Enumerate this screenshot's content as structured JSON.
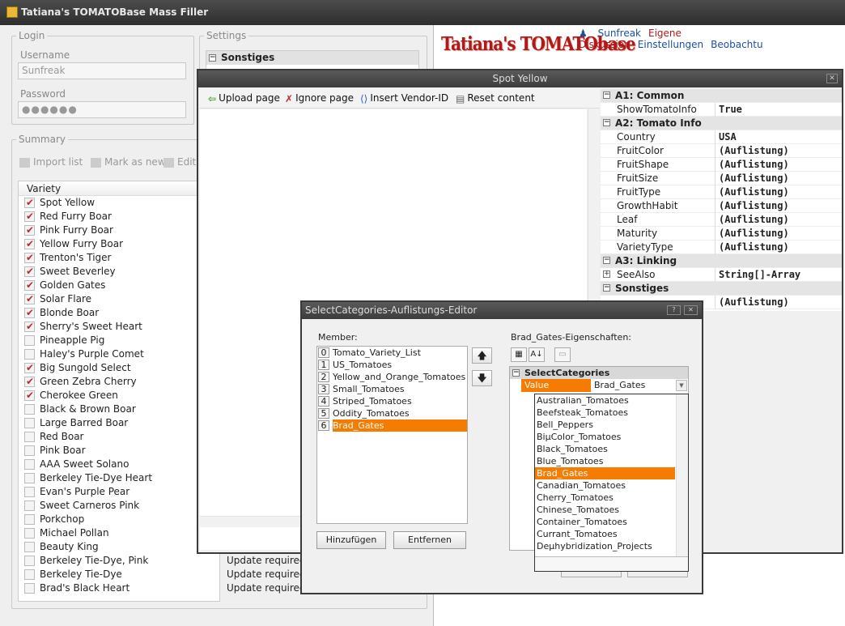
{
  "window": {
    "title": "Tatiana's TOMATOBase Mass Filler"
  },
  "login": {
    "legend": "Login",
    "username_label": "Username",
    "username_value": "Sunfreak",
    "password_label": "Password",
    "password_value": "●●●●●●"
  },
  "settings": {
    "legend": "Settings",
    "category": "Sonstiges"
  },
  "summary": {
    "legend": "Summary",
    "import": "Import list",
    "mark": "Mark as new",
    "edit": "Edit"
  },
  "variety_list": {
    "header": "Variety",
    "rows": [
      {
        "name": "Spot Yellow",
        "checked": true,
        "status": ""
      },
      {
        "name": "Red Furry Boar",
        "checked": true,
        "status": ""
      },
      {
        "name": "Pink Furry Boar",
        "checked": true,
        "status": ""
      },
      {
        "name": "Yellow Furry Boar",
        "checked": true,
        "status": ""
      },
      {
        "name": "Trenton's Tiger",
        "checked": true,
        "status": ""
      },
      {
        "name": "Sweet Beverley",
        "checked": true,
        "status": ""
      },
      {
        "name": "Golden Gates",
        "checked": true,
        "status": ""
      },
      {
        "name": "Solar Flare",
        "checked": true,
        "status": ""
      },
      {
        "name": "Blonde Boar",
        "checked": true,
        "status": ""
      },
      {
        "name": "Sherry's Sweet Heart",
        "checked": true,
        "status": ""
      },
      {
        "name": "Pineapple Pig",
        "checked": false,
        "status": ""
      },
      {
        "name": "Haley's Purple Comet",
        "checked": false,
        "status": ""
      },
      {
        "name": "Big Sungold Select",
        "checked": true,
        "status": ""
      },
      {
        "name": "Green Zebra Cherry",
        "checked": true,
        "status": ""
      },
      {
        "name": "Cherokee Green",
        "checked": true,
        "status": ""
      },
      {
        "name": "Black & Brown Boar",
        "checked": false,
        "status": ""
      },
      {
        "name": "Large Barred Boar",
        "checked": false,
        "status": ""
      },
      {
        "name": "Red Boar",
        "checked": false,
        "status": ""
      },
      {
        "name": "Pink Boar",
        "checked": false,
        "status": ""
      },
      {
        "name": "AAA Sweet Solano",
        "checked": false,
        "status": ""
      },
      {
        "name": "Berkeley Tie-Dye Heart",
        "checked": false,
        "status": ""
      },
      {
        "name": "Evan's Purple Pear",
        "checked": false,
        "status": ""
      },
      {
        "name": "Sweet Carneros Pink",
        "checked": false,
        "status": ""
      },
      {
        "name": "Porkchop",
        "checked": false,
        "status": ""
      },
      {
        "name": "Michael Pollan",
        "checked": false,
        "status": ""
      },
      {
        "name": "Beauty King",
        "checked": false,
        "status": ""
      },
      {
        "name": "Berkeley Tie-Dye, Pink",
        "checked": false,
        "status": "Update required"
      },
      {
        "name": "Berkeley Tie-Dye",
        "checked": false,
        "status": "Update required"
      },
      {
        "name": "Brad's Black Heart",
        "checked": false,
        "status": "Update required"
      }
    ]
  },
  "browser": {
    "brand": "Tatiana's TOMATObase",
    "links": [
      {
        "text": "Sunfreak",
        "color": "blue"
      },
      {
        "text": "Eigene Diskussion",
        "color": "red"
      },
      {
        "text": "Einstellungen",
        "color": "blue"
      },
      {
        "text": "Beobachtu",
        "color": "blue"
      }
    ]
  },
  "spot": {
    "title": "Spot Yellow",
    "toolbar": {
      "upload": "Upload page",
      "ignore": "Ignore page",
      "insert": "Insert Vendor-ID",
      "reset": "Reset content"
    }
  },
  "property_grid": [
    {
      "type": "cat",
      "label": "A1: Common"
    },
    {
      "type": "prop",
      "key": "ShowTomatoInfo",
      "value": "True"
    },
    {
      "type": "cat",
      "label": "A2: Tomato Info"
    },
    {
      "type": "prop",
      "key": "Country",
      "value": "USA"
    },
    {
      "type": "prop",
      "key": "FruitColor",
      "value": "(Auflistung)"
    },
    {
      "type": "prop",
      "key": "FruitShape",
      "value": "(Auflistung)"
    },
    {
      "type": "prop",
      "key": "FruitSize",
      "value": "(Auflistung)"
    },
    {
      "type": "prop",
      "key": "FruitType",
      "value": "(Auflistung)"
    },
    {
      "type": "prop",
      "key": "GrowthHabit",
      "value": "(Auflistung)"
    },
    {
      "type": "prop",
      "key": "Leaf",
      "value": "(Auflistung)"
    },
    {
      "type": "prop",
      "key": "Maturity",
      "value": "(Auflistung)"
    },
    {
      "type": "prop",
      "key": "VarietyType",
      "value": "(Auflistung)"
    },
    {
      "type": "cat",
      "label": "A3: Linking"
    },
    {
      "type": "prop",
      "key": "SeeAlso",
      "value": "String[]-Array",
      "expandable": true
    },
    {
      "type": "cat",
      "label": "Sonstiges"
    },
    {
      "type": "prop",
      "key": "",
      "value": "(Auflistung)"
    }
  ],
  "editor": {
    "title": "SelectCategories-Auflistungs-Editor",
    "member_label": "Member:",
    "members": [
      "Tomato_Variety_List",
      "US_Tomatoes",
      "Yellow_and_Orange_Tomatoes",
      "Small_Tomatoes",
      "Striped_Tomatoes",
      "Oddity_Tomatoes",
      "Brad_Gates"
    ],
    "selected_member": 6,
    "add_button": "Hinzufügen",
    "remove_button": "Entfernen",
    "props_label": "Brad_Gates-Eigenschaften:",
    "category": "SelectCategories",
    "value_key": "Value",
    "value": "Brad_Gates",
    "options": [
      "Australian_Tomatoes",
      "Beefsteak_Tomatoes",
      "Bell_Peppers",
      "BiµColor_Tomatoes",
      "Black_Tomatoes",
      "Blue_Tomatoes",
      "Brad_Gates",
      "Canadian_Tomatoes",
      "Cherry_Tomatoes",
      "Chinese_Tomatoes",
      "Container_Tomatoes",
      "Currant_Tomatoes",
      "Deµhybridization_Projects"
    ],
    "selected_option": 6
  },
  "colors": {
    "accent": "#f57c00",
    "title_bar": "#3c3c3c",
    "brand_red": "#b0181a",
    "link_blue": "#1b4fa3"
  }
}
